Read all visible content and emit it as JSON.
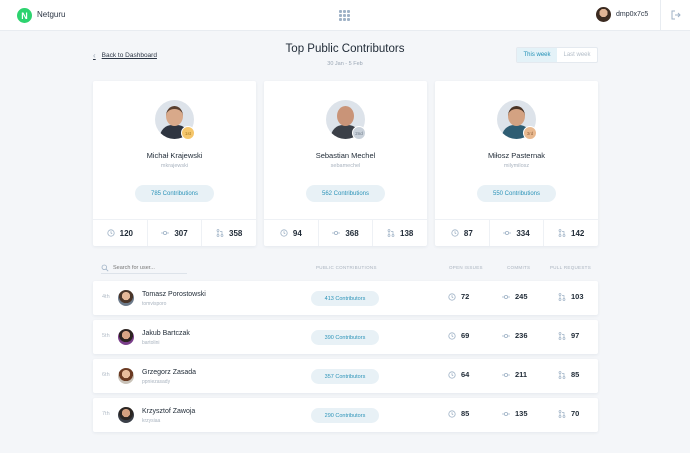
{
  "app": {
    "brand": "Netguru",
    "logo_letter": "N",
    "username": "dmp0x7c5"
  },
  "header": {
    "back_label": "Back to Dashboard",
    "title": "Top Public Contributors",
    "subtitle": "30 Jan - 5 Feb",
    "toggle": {
      "this_week": "This week",
      "last_week": "Last week"
    }
  },
  "top_contributors": [
    {
      "rank": "1st",
      "name": "Michał Krajewski",
      "handle": "mkrajewski",
      "contributions": "785 Contributions",
      "open_issues": "120",
      "commits": "307",
      "pull_requests": "358"
    },
    {
      "rank": "2nd",
      "name": "Sebastian Mechel",
      "handle": "sebamechel",
      "contributions": "562 Contributions",
      "open_issues": "94",
      "commits": "368",
      "pull_requests": "138"
    },
    {
      "rank": "3rd",
      "name": "Miłosz Pasternak",
      "handle": "milymilosz",
      "contributions": "550 Contributions",
      "open_issues": "87",
      "commits": "334",
      "pull_requests": "142"
    }
  ],
  "table": {
    "search_placeholder": "Search for user...",
    "columns": {
      "contributions": "PUBLIC CONTRIBUTIONS",
      "open_issues": "OPEN ISSUES",
      "commits": "COMMITS",
      "pull_requests": "PULL REQUESTS"
    },
    "rows": [
      {
        "rank": "4th",
        "name": "Tomasz Porostowski",
        "handle": "tomvisporo",
        "contributions": "413 Contributors",
        "open_issues": "72",
        "commits": "245",
        "pull_requests": "103"
      },
      {
        "rank": "5th",
        "name": "Jakub Bartczak",
        "handle": "bartolini",
        "contributions": "390 Contributors",
        "open_issues": "69",
        "commits": "236",
        "pull_requests": "97"
      },
      {
        "rank": "6th",
        "name": "Grzegorz Zasada",
        "handle": "ppniezasady",
        "contributions": "357 Contributors",
        "open_issues": "64",
        "commits": "211",
        "pull_requests": "85"
      },
      {
        "rank": "7th",
        "name": "Krzysztof Zawoja",
        "handle": "krzysiaa",
        "contributions": "290 Contributors",
        "open_issues": "85",
        "commits": "135",
        "pull_requests": "70"
      }
    ]
  },
  "colors": {
    "accent": "#2b93b8",
    "brand_green": "#2dd36f",
    "gold": "#f5c66b",
    "silver": "#c9d1da",
    "bronze": "#e9b98f"
  }
}
